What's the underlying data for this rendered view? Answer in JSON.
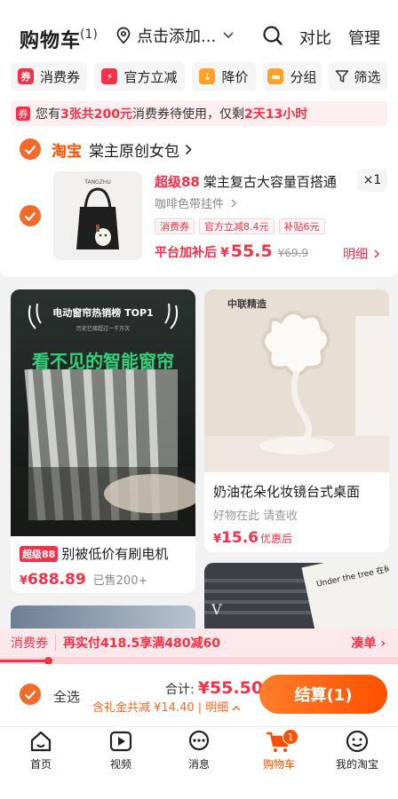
{
  "header": {
    "title": "购物车",
    "count": "(1)",
    "location": "点击添加...",
    "compare": "对比",
    "manage": "管理"
  },
  "chips": [
    {
      "label": "消费券",
      "icon": "coupon-icon",
      "color": "#f43149"
    },
    {
      "label": "官方立减",
      "icon": "discount-icon",
      "color": "#f43149"
    },
    {
      "label": "降价",
      "icon": "price-drop-icon",
      "color": "#ffa12a"
    },
    {
      "label": "分组",
      "icon": "folder-icon",
      "color": "#ffa12a"
    },
    {
      "label": "筛选",
      "icon": "filter-icon",
      "color": "#333333"
    }
  ],
  "banner": {
    "pre": "您有",
    "coupons": "3张共200元",
    "mid": "消费券待使用，仅剩",
    "time": "2天13小时"
  },
  "store": {
    "platform": "淘宝",
    "name": "棠主原创女包"
  },
  "product": {
    "badge": "超级88",
    "title": "棠主复古大容量百搭通",
    "sku": "咖啡色带挂件",
    "qty": "×1",
    "tags": [
      "消费券",
      "官方立减8.4元",
      "补贴6元"
    ],
    "final_label": "平台加补后",
    "currency": "¥",
    "price": "55.5",
    "orig_price": "¥69.9",
    "detail": "明细",
    "brand_text": "TANGZHU"
  },
  "recs": [
    {
      "name": "rec-card-curtain",
      "badge": "超级88",
      "title": "别被低价有刷电机",
      "price": "688.89",
      "sold": "已售200+",
      "img_top": "电动窗帘热销榜 TOP1",
      "img_sub": "历史已接超过一千万次",
      "img_headline": "看不见的智能窗帘"
    },
    {
      "name": "rec-card-mirror",
      "title": "奶油花朵化妆镜台式桌面",
      "tagline": "好物在此 请查收",
      "price": "15.6",
      "price_note": "优惠后",
      "img_brand": "中联精造"
    },
    {
      "name": "rec-card-partial-1"
    },
    {
      "name": "rec-card-partial-2",
      "img_text": "Under the tree 在树下 For you"
    }
  ],
  "coupon_bar": {
    "label": "消费券",
    "text": "再实付418.5享满480减60",
    "action": "凑单",
    "progress": 0.12
  },
  "checkout": {
    "select_all": "全选",
    "total_label": "合计:",
    "total": "¥55.50",
    "gift": "含礼金共减 ¥14.40 | 明细",
    "submit": "结算(1)"
  },
  "tabs": [
    {
      "label": "首页",
      "icon": "home-icon"
    },
    {
      "label": "视频",
      "icon": "video-icon"
    },
    {
      "label": "消息",
      "icon": "message-icon"
    },
    {
      "label": "购物车",
      "icon": "cart-icon",
      "badge": "1",
      "active": true
    },
    {
      "label": "我的淘宝",
      "icon": "profile-icon"
    }
  ],
  "colors": {
    "accent": "#ff5000",
    "red": "#f43149",
    "check": "#f36b2a"
  }
}
